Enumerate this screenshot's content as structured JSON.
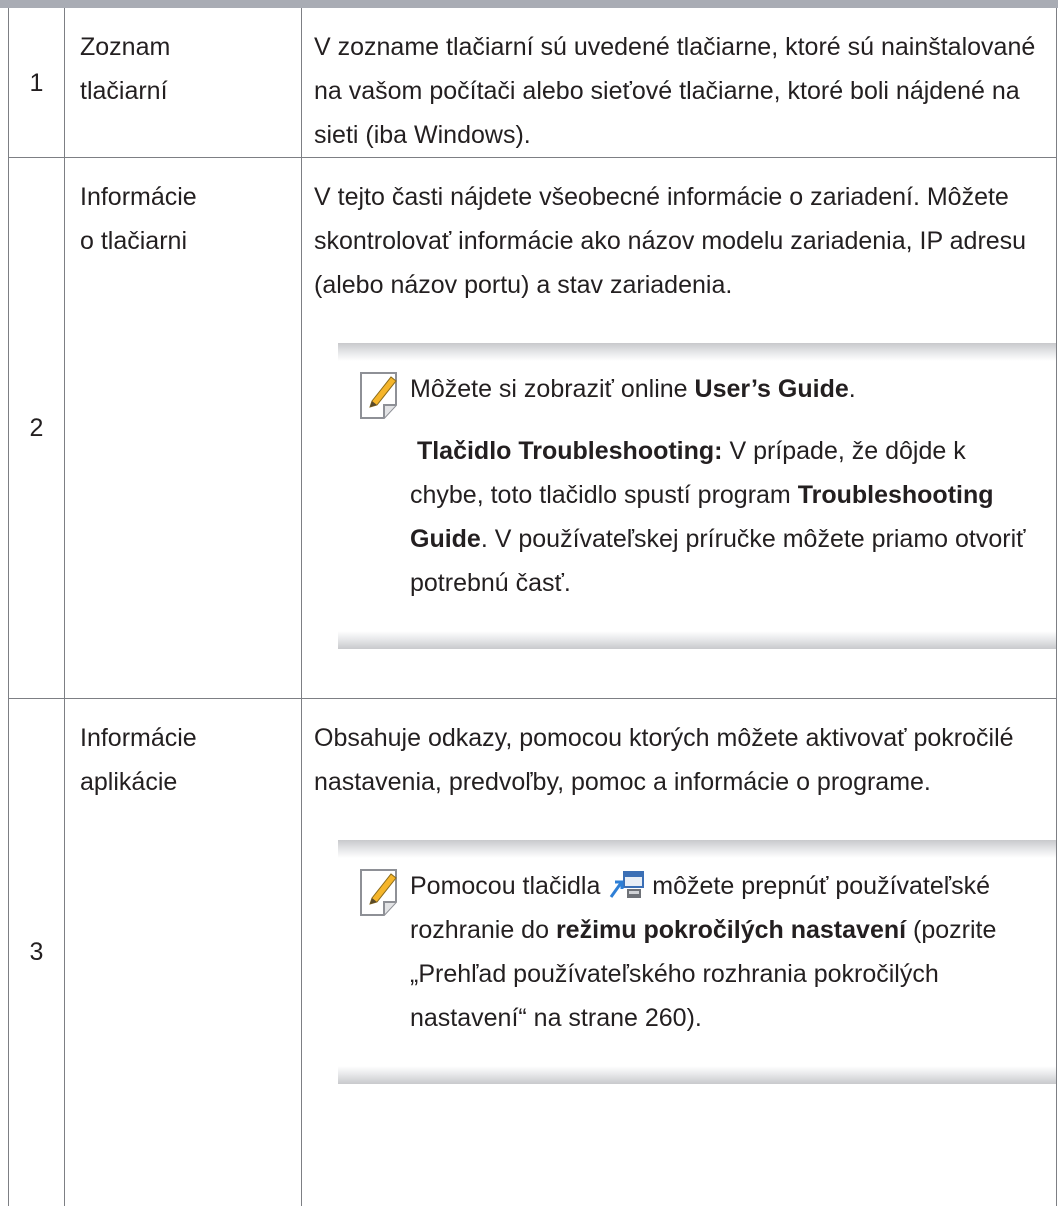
{
  "rows": [
    {
      "number": "1",
      "name_lines": [
        "Zoznam",
        "tlačiarní"
      ],
      "description": "V zozname tlačiarní sú uvedené tlačiarne, ktoré sú nainštalované na vašom počítači alebo sieťové tlačiarne, ktoré boli nájdené na sieti (iba Windows)."
    },
    {
      "number": "2",
      "name_lines": [
        "Informácie",
        "o tlačiarni"
      ],
      "description": "V tejto časti nájdete všeobecné informácie o zariadení. Môžete skontrolovať informácie ako názov modelu zariadenia, IP adresu (alebo názov portu) a stav zariadenia.",
      "note": {
        "icon": "note-pencil-icon",
        "p1_text": "Môžete si zobraziť online ",
        "p1_bold": "User’s Guide",
        "p1_end": ".",
        "p2_bold": "Tlačidlo Troubleshooting:",
        "p2_text": " V prípade, že dôjde k chybe, toto tlačidlo spustí program ",
        "p2_bold2": "Troubleshooting Guide",
        "p2_end": ". V používateľskej príručke môžete priamo otvoriť potrebnú časť."
      }
    },
    {
      "number": "3",
      "name_lines": [
        "Informácie",
        "aplikácie"
      ],
      "description": "Obsahuje odkazy, pomocou ktorých môžete aktivovať pokročilé nastavenia, predvoľby, pomoc a informácie o programe.",
      "note": {
        "icon": "note-pencil-icon",
        "switch_icon": "switch-mode-icon",
        "text1": "Pomocou tlačidla ",
        "text2": " môžete prepnúť používateľské rozhranie do ",
        "bold": "režimu pokročilých nastavení",
        "text3": " (pozrite „Prehľad používateľského rozhrania pokročilých nastavení“ na strane 260)."
      }
    }
  ]
}
